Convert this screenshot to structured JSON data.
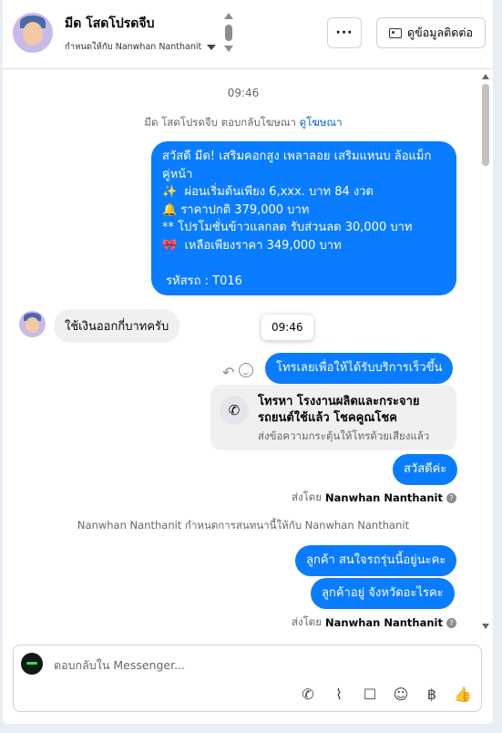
{
  "header": {
    "name": "มีด โสดโปรดจีบ",
    "assigned_to": "กำหนดให้กับ Nanwhan Nanthanit",
    "more_label": "···",
    "contact_button": "ดูข้อมูลติดต่อ"
  },
  "thread": {
    "timestamp": "09:46",
    "ad_reply_text": "มีด โสดโปรดจีบ ตอบกลับโฆษณา",
    "ad_link": "ดูโฆษณา",
    "ad_message": "สวัสดี มีด! เสริมคอกสูง เพลาลอย เสริมแหนบ ล้อแม็ก\nคู่หน้า\n✨  ผ่อนเริ่มต้นเพียง 6,xxx. บาท 84 งวด\n🔔 ราคาปกติ 379,000 บาท\n** โปรโมชั่นข้าวแลกลด รับส่วนลด 30,000 บาท\n🎀  เหลือเพียงราคา 349,000 บาท\n\n รหัสรถ : T016",
    "customer_message": "ใช้เงินออกกี่บาทครับ",
    "tooltip_time": "09:46",
    "reply_call_cta": "โทรเลยเพื่อให้ได้รับบริการเร็วขึ้น",
    "call_card_title": "โทรหา โรงงานผลิตและกระจาย\nรถยนต์ใช้แล้ว โชคคูณโชค",
    "call_card_sub": "ส่งข้อความกระตุ้นให้โทรด้วยเสียงแล้ว",
    "greeting": "สวัสดีค่ะ",
    "sent_by_prefix": "ส่งโดย",
    "sent_by_name": "Nanwhan Nanthanit",
    "assignment_note": "Nanwhan Nanthanit กำหนดการสนทนานี้ให้กับ Nanwhan Nanthanit",
    "question_1": "ลูกค้า สนใจรถรุ่นนี้อยู่นะคะ",
    "question_2": "ลูกค้าอยู่ จังหวัดอะไรคะ",
    "sent_by_prefix_2": "ส่งโดย",
    "sent_by_name_2": "Nanwhan Nanthanit"
  },
  "composer": {
    "placeholder": "ตอบกลับใน Messenger..."
  },
  "colors": {
    "outgoing_bubble": "#0a7cff",
    "incoming_bubble": "#f0f0f0",
    "link": "#0064d1"
  },
  "icons": {
    "tools": [
      "phone-plus-icon",
      "attach-icon",
      "saved-reply-icon",
      "emoji-icon",
      "baht-icon",
      "like-icon"
    ]
  }
}
